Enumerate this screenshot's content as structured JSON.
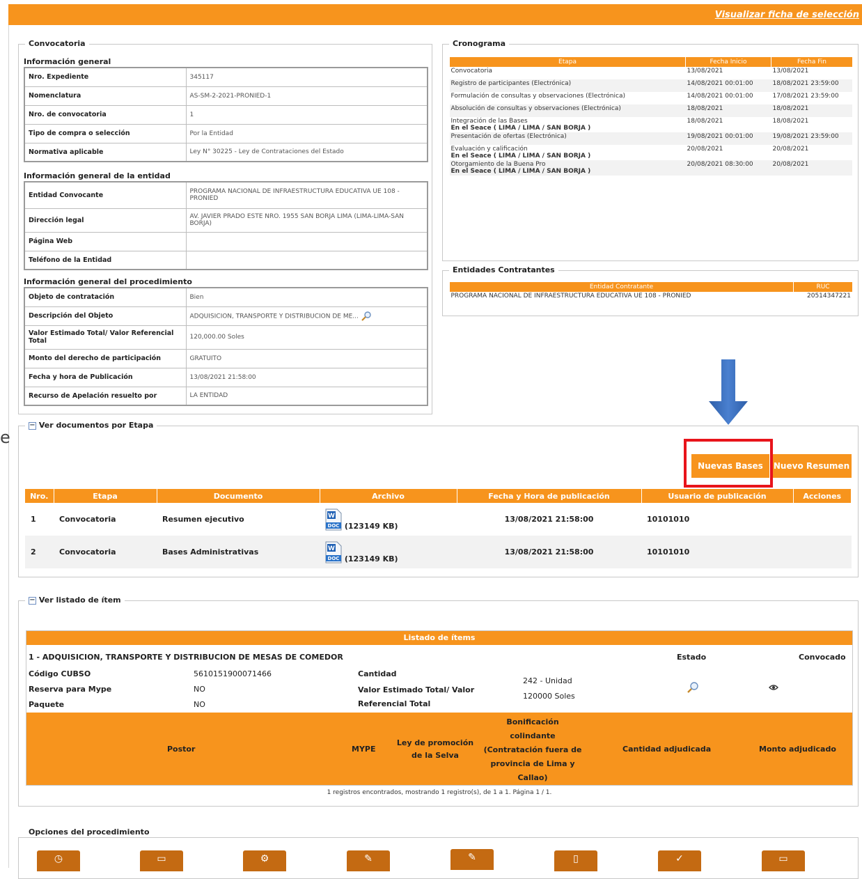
{
  "header": {
    "link": "Visualizar ficha de selección"
  },
  "stray_char": "e",
  "convocatoria": {
    "legend": "Convocatoria",
    "general_title": "Información general",
    "general": [
      {
        "k": "Nro. Expediente",
        "v": "345117"
      },
      {
        "k": "Nomenclatura",
        "v": "AS-SM-2-2021-PRONIED-1"
      },
      {
        "k": "Nro. de convocatoria",
        "v": "1"
      },
      {
        "k": "Tipo de compra o selección",
        "v": "Por la Entidad"
      },
      {
        "k": "Normativa aplicable",
        "v": "Ley N° 30225 - Ley de Contrataciones del Estado"
      }
    ],
    "entidad_title": "Información general de la entidad",
    "entidad": [
      {
        "k": "Entidad Convocante",
        "v": "PROGRAMA NACIONAL DE INFRAESTRUCTURA EDUCATIVA UE 108 - PRONIED"
      },
      {
        "k": "Dirección legal",
        "v": "AV. JAVIER PRADO ESTE NRO. 1955 SAN BORJA LIMA (LIMA-LIMA-SAN BORJA)"
      },
      {
        "k": "Página Web",
        "v": ""
      },
      {
        "k": "Teléfono de la Entidad",
        "v": ""
      }
    ],
    "proc_title": "Información general del procedimiento",
    "proc": [
      {
        "k": "Objeto de contratación",
        "v": "Bien"
      },
      {
        "k": "Descripción del Objeto",
        "v": "ADQUISICION, TRANSPORTE Y DISTRIBUCION DE ME..."
      },
      {
        "k": "Valor Estimado Total/ Valor Referencial Total",
        "v": "120,000.00 Soles"
      },
      {
        "k": "Monto del derecho de participación",
        "v": "GRATUITO"
      },
      {
        "k": "Fecha y hora de Publicación",
        "v": "13/08/2021 21:58:00"
      },
      {
        "k": "Recurso de Apelación resuelto por",
        "v": "LA ENTIDAD"
      }
    ]
  },
  "cronograma": {
    "legend": "Cronograma",
    "headers": [
      "Etapa",
      "Fecha Inicio",
      "Fecha Fin"
    ],
    "rows": [
      {
        "etapa": "Convocatoria",
        "sub": "",
        "ini": "13/08/2021",
        "fin": "13/08/2021"
      },
      {
        "etapa": "Registro de participantes (Electrónica)",
        "sub": "",
        "ini": "14/08/2021 00:01:00",
        "fin": "18/08/2021 23:59:00"
      },
      {
        "etapa": "Formulación de consultas y observaciones (Electrónica)",
        "sub": "",
        "ini": "14/08/2021 00:01:00",
        "fin": "17/08/2021 23:59:00"
      },
      {
        "etapa": "Absolución de consultas y observaciones (Electrónica)",
        "sub": "",
        "ini": "18/08/2021",
        "fin": "18/08/2021"
      },
      {
        "etapa": "Integración de las Bases",
        "sub": "En el Seace ( LIMA / LIMA / SAN BORJA )",
        "ini": "18/08/2021",
        "fin": "18/08/2021"
      },
      {
        "etapa": "Presentación de ofertas (Electrónica)",
        "sub": "",
        "ini": "19/08/2021 00:01:00",
        "fin": "19/08/2021 23:59:00"
      },
      {
        "etapa": "Evaluación y calificación",
        "sub": "En el Seace ( LIMA / LIMA / SAN BORJA )",
        "ini": "20/08/2021",
        "fin": "20/08/2021"
      },
      {
        "etapa": "Otorgamiento de la Buena Pro",
        "sub": "En el Seace ( LIMA / LIMA / SAN BORJA )",
        "ini": "20/08/2021 08:30:00",
        "fin": "20/08/2021"
      }
    ]
  },
  "entidades": {
    "legend": "Entidades Contratantes",
    "headers": [
      "Entidad Contratante",
      "RUC"
    ],
    "name": "PROGRAMA NACIONAL DE INFRAESTRUCTURA EDUCATIVA UE 108 - PRONIED",
    "ruc": "20514347221"
  },
  "docs": {
    "legend": "Ver documentos por Etapa",
    "btn_bases": "Nuevas Bases",
    "btn_resumen": "Nuevo Resumen",
    "headers": [
      "Nro.",
      "Etapa",
      "Documento",
      "Archivo",
      "Fecha y Hora de publicación",
      "Usuario de publicación",
      "Acciones"
    ],
    "rows": [
      {
        "nro": "1",
        "etapa": "Convocatoria",
        "doc": "Resumen ejecutivo",
        "size": "(123149 KB)",
        "fecha": "13/08/2021 21:58:00",
        "user": "10101010"
      },
      {
        "nro": "2",
        "etapa": "Convocatoria",
        "doc": "Bases Administrativas",
        "size": "(123149 KB)",
        "fecha": "13/08/2021 21:58:00",
        "user": "10101010"
      }
    ]
  },
  "items": {
    "legend": "Ver listado de ítem",
    "title": "Listado de ítems",
    "item_name": "1 - ADQUISICION, TRANSPORTE Y DISTRIBUCION DE MESAS DE COMEDOR",
    "estado": "Estado",
    "convocado": "Convocado",
    "cubso_k": "Código CUBSO",
    "cubso_v": "5610151900071466",
    "mype_k": "Reserva para Mype",
    "mype_v": "NO",
    "paquete_k": "Paquete",
    "paquete_v": "NO",
    "cantidad_k": "Cantidad",
    "cantidad_v": "242 - Unidad",
    "valor_k1": "Valor Estimado Total/ Valor",
    "valor_k2": "Referencial Total",
    "valor_v": "120000 Soles",
    "cols": {
      "postor": "Postor",
      "mype": "MYPE",
      "selva1": "Ley de promoción",
      "selva2": "de la Selva",
      "bon1": "Bonificación",
      "bon2": "colindante",
      "bon3": "(Contratación fuera de",
      "bon4": "provincia de Lima y",
      "bon5": "Callao)",
      "cant": "Cantidad adjudicada",
      "monto": "Monto adjudicado"
    },
    "footer": "1 registros encontrados, mostrando 1 registro(s), de 1 a 1. Página 1 / 1."
  },
  "opciones": {
    "legend": "Opciones del procedimiento"
  },
  "colors": {
    "accent": "#f7941d",
    "highlight": "#e8141b",
    "arrow": "#3b6fc4"
  }
}
